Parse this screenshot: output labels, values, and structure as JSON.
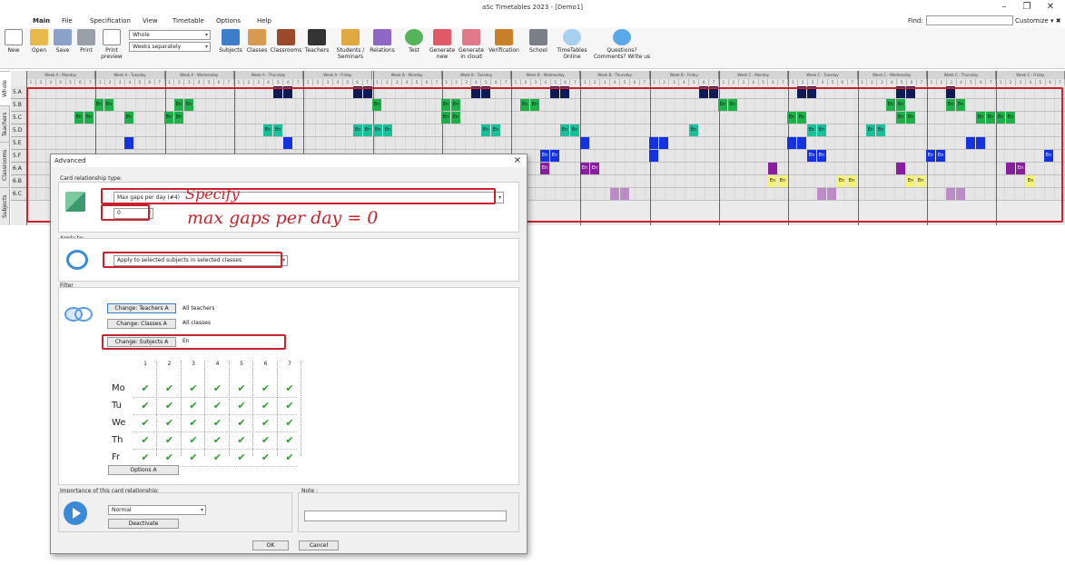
{
  "app": {
    "title": "aSc Timetables 2023  - [Demo1]"
  },
  "menu": {
    "items": [
      "Main",
      "File",
      "Specification",
      "View",
      "Timetable",
      "Options",
      "Help"
    ],
    "find_label": "Find:",
    "customize": "Customize"
  },
  "ribbon": {
    "new": "New",
    "open": "Open",
    "save": "Save",
    "print": "Print",
    "print_preview": "Print preview",
    "view_select": "Whole",
    "weeks_select": "Weeks separately",
    "subjects": "Subjects",
    "classes": "Classes",
    "classrooms": "Classrooms",
    "teachers": "Teachers",
    "students": "Students / Seminars",
    "relations": "Relations",
    "test": "Test",
    "generate_new": "Generate new",
    "generate_cloud": "Generate in cloud",
    "verification": "Verification",
    "school": "School",
    "tt_online": "TimeTables Online",
    "questions": "Questions? Comments? Write us"
  },
  "vtabs": [
    "Whole",
    "Teachers",
    "Classrooms",
    "Subjects"
  ],
  "grid": {
    "days": [
      "Week A - Monday",
      "Week A - Tuesday",
      "Week A - Wednesday",
      "Week A - Thursday",
      "Week A - Friday",
      "Week B - Monday",
      "Week B - Tuesday",
      "Week B - Wednesday",
      "Week B - Thursday",
      "Week B - Friday",
      "Week C - Monday",
      "Week C - Tuesday",
      "Week C - Wednesday",
      "Week C - Thursday",
      "Week C - Friday"
    ],
    "periods": [
      "1",
      "2",
      "3",
      "4",
      "5",
      "6",
      "7"
    ],
    "rows": [
      "5.A",
      "5.B",
      "5.C",
      "5.D",
      "5.E",
      "5.F",
      "6.A",
      "6.B",
      "6.C"
    ],
    "cell_label": "En"
  },
  "dialog": {
    "title": "Advanced",
    "close": "×",
    "crt_label": "Card relationship type:",
    "crt_value": "Max gaps per day (#4)",
    "gaps_value": "0",
    "apply_label": "Apply to:",
    "apply_value": "Apply to selected subjects in selected classes",
    "filter_label": "Filter",
    "teachers_btn": "Change: Teachers A",
    "teachers_val": "All teachers",
    "classes_btn": "Change: Classes A",
    "classes_val": "All classes",
    "subjects_btn": "Change: Subjects A",
    "subjects_val": "En",
    "days": [
      "Mo",
      "Tu",
      "We",
      "Th",
      "Fr"
    ],
    "periods": [
      "1",
      "2",
      "3",
      "4",
      "5",
      "6",
      "7"
    ],
    "options_btn": "Options A",
    "importance_label": "Importance of this card relationship:",
    "importance_value": "Normal",
    "deactivate_btn": "Deactivate",
    "note_label": "Note :",
    "ok": "OK",
    "cancel": "Cancel"
  },
  "annotation": {
    "line1": "Specify",
    "line2": "max gaps per day = 0"
  },
  "colors": {
    "green": "#1fb04a",
    "teal": "#1bbf9a",
    "navy": "#0d1a55",
    "blue": "#1432e0",
    "purple": "#8a1ea0",
    "yellow": "#f5f27a",
    "red": "#c8232c"
  }
}
